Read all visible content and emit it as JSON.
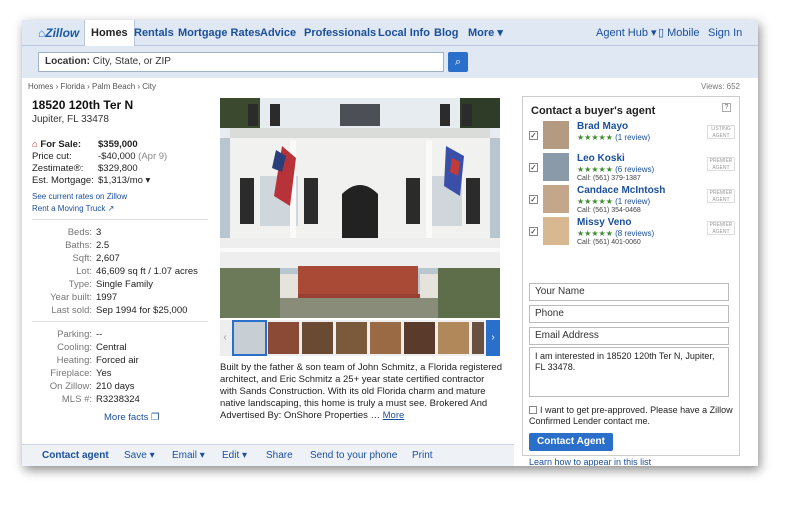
{
  "nav": {
    "logo": "Zillow",
    "tabs": [
      "Homes",
      "Rentals",
      "Mortgage Rates",
      "Advice",
      "Professionals",
      "Local Info",
      "Blog",
      "More ▾"
    ],
    "right": [
      "Agent Hub ▾",
      "Mobile",
      "Sign In"
    ]
  },
  "location": {
    "label": "Location:",
    "placeholder": "City, State, or ZIP"
  },
  "breadcrumb": "Homes › Florida › Palm Beach › City",
  "views": "Views: 652",
  "listing": {
    "address": "18520 120th Ter N",
    "city": "Jupiter, FL 33478",
    "for_sale_label": "For Sale:",
    "for_sale_value": "$359,000",
    "price_cut_label": "Price cut:",
    "price_cut_value": "-$40,000",
    "price_cut_date": "(Apr 9)",
    "zestimate_label": "Zestimate®:",
    "zestimate_value": "$329,800",
    "mortgage_label": "Est. Mortgage:",
    "mortgage_value": "$1,313/mo ▾",
    "link_rates": "See current rates on Zillow",
    "link_truck": "Rent a Moving Truck",
    "facts": [
      {
        "k": "Beds:",
        "v": "3"
      },
      {
        "k": "Baths:",
        "v": "2.5"
      },
      {
        "k": "Sqft:",
        "v": "2,607"
      },
      {
        "k": "Lot:",
        "v": "46,609 sq ft / 1.07 acres"
      },
      {
        "k": "Type:",
        "v": "Single Family"
      },
      {
        "k": "Year built:",
        "v": "1997"
      },
      {
        "k": "Last sold:",
        "v": "Sep 1994 for $25,000"
      }
    ],
    "facts2": [
      {
        "k": "Parking:",
        "v": "--"
      },
      {
        "k": "Cooling:",
        "v": "Central"
      },
      {
        "k": "Heating:",
        "v": "Forced air"
      },
      {
        "k": "Fireplace:",
        "v": "Yes"
      },
      {
        "k": "On Zillow:",
        "v": "210 days"
      },
      {
        "k": "MLS #:",
        "v": "R3238324"
      }
    ],
    "more_facts": "More facts",
    "description": "Built by the father & son team of John Schmitz, a Florida registered architect, and Eric Schmitz a 25+ year state certified contractor with Sands Construction. With its old Florida charm and mature native landscaping, this home is truly a must see. Brokered And Advertised By: OnShore Properties … ",
    "description_more": "More"
  },
  "actions": [
    "Contact agent",
    "Save ▾",
    "Email ▾",
    "Edit ▾",
    "Share",
    "Send to your phone",
    "Print"
  ],
  "panel": {
    "title": "Contact a buyer's agent",
    "agents": [
      {
        "name": "Brad Mayo",
        "reviews": "(1 review)",
        "call": "",
        "badge": "LISTING AGENT"
      },
      {
        "name": "Leo Koski",
        "reviews": "(6 reviews)",
        "call": "Call: (561) 379-1387",
        "badge": "PREMIER AGENT"
      },
      {
        "name": "Candace McIntosh",
        "reviews": "(1 review)",
        "call": "Call: (561) 354-0468",
        "badge": "PREMIER AGENT"
      },
      {
        "name": "Missy Veno",
        "reviews": "(8 reviews)",
        "call": "Call: (561) 401-0060",
        "badge": "PREMIER AGENT"
      }
    ],
    "stars": "★★★★★",
    "name_placeholder": "Your Name",
    "phone_placeholder": "Phone",
    "email_placeholder": "Email Address",
    "message": "I am interested in 18520 120th Ter N, Jupiter, FL 33478.",
    "preapproved": "I want to get pre-approved. Please have a Zillow Confirmed Lender contact me.",
    "contact_button": "Contact Agent",
    "learn": "Learn how to appear in this list"
  }
}
